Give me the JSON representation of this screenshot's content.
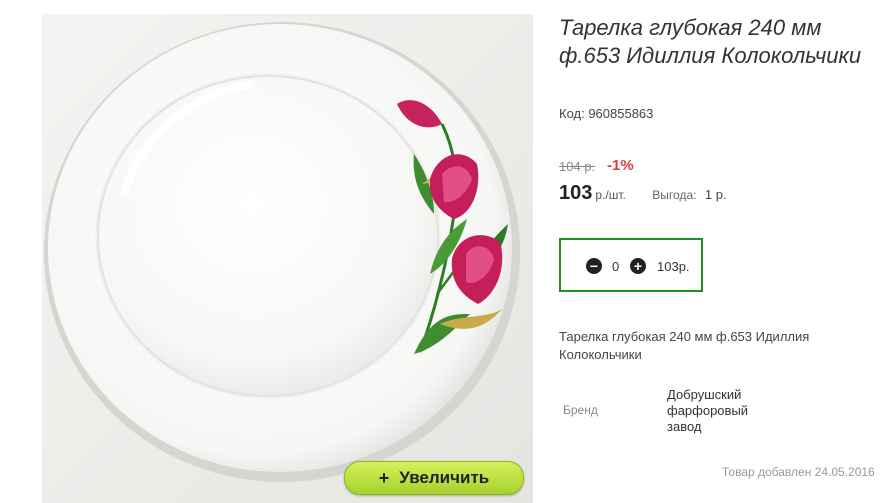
{
  "product": {
    "title": "Тарелка глубокая 240 мм ф.653 Идиллия Колокольчики",
    "code": "Код: 960855863",
    "description": "Тарелка глубокая 240 мм ф.653 Идиллия Колокольчики",
    "added": "Товар добавлен 24.05.2016"
  },
  "pricing": {
    "old_price": "104 р.",
    "discount": "-1%",
    "price": "103",
    "unit": "р./шт.",
    "benefit_label": "Выгода:",
    "benefit_value": "1 р."
  },
  "quantity": {
    "minus_icon": "minus-circle-icon",
    "plus_icon": "plus-circle-icon",
    "value": "0",
    "total": "103р."
  },
  "brand": {
    "label": "Бренд",
    "value": "Добрушский фарфоровый завод"
  },
  "zoom": {
    "plus": "+",
    "label": "Увеличить"
  },
  "colors": {
    "accent_green": "#1f8f2a",
    "discount_red": "#e03a3e",
    "zoom_button": "#b6dc3b"
  }
}
